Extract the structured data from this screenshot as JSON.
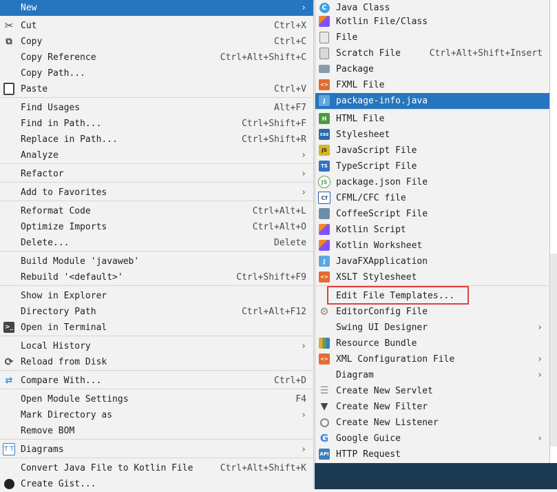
{
  "main_menu": {
    "items": [
      {
        "label": "New",
        "shortcut": "",
        "submenu": true,
        "selected": true,
        "icon": ""
      },
      {
        "label": "Cut",
        "shortcut": "Ctrl+X",
        "icon": "scissors-icon"
      },
      {
        "label": "Copy",
        "shortcut": "Ctrl+C",
        "icon": "copy-icon"
      },
      {
        "label": "Copy Reference",
        "shortcut": "Ctrl+Alt+Shift+C"
      },
      {
        "label": "Copy Path...",
        "shortcut": ""
      },
      {
        "label": "Paste",
        "shortcut": "Ctrl+V",
        "icon": "clipboard-icon"
      },
      {
        "label": "Find Usages",
        "shortcut": "Alt+F7"
      },
      {
        "label": "Find in Path...",
        "shortcut": "Ctrl+Shift+F"
      },
      {
        "label": "Replace in Path...",
        "shortcut": "Ctrl+Shift+R"
      },
      {
        "label": "Analyze",
        "shortcut": "",
        "submenu": true
      },
      {
        "label": "Refactor",
        "shortcut": "",
        "submenu": true
      },
      {
        "label": "Add to Favorites",
        "shortcut": "",
        "submenu": true
      },
      {
        "label": "Reformat Code",
        "shortcut": "Ctrl+Alt+L"
      },
      {
        "label": "Optimize Imports",
        "shortcut": "Ctrl+Alt+O"
      },
      {
        "label": "Delete...",
        "shortcut": "Delete"
      },
      {
        "label": "Build Module 'javaweb'",
        "shortcut": ""
      },
      {
        "label": "Rebuild '<default>'",
        "shortcut": "Ctrl+Shift+F9"
      },
      {
        "label": "Show in Explorer",
        "shortcut": ""
      },
      {
        "label": "Directory Path",
        "shortcut": "Ctrl+Alt+F12"
      },
      {
        "label": "Open in Terminal",
        "shortcut": "",
        "icon": "terminal-icon"
      },
      {
        "label": "Local History",
        "shortcut": "",
        "submenu": true
      },
      {
        "label": "Reload from Disk",
        "shortcut": "",
        "icon": "reload-icon"
      },
      {
        "label": "Compare With...",
        "shortcut": "Ctrl+D",
        "icon": "compare-icon"
      },
      {
        "label": "Open Module Settings",
        "shortcut": "F4"
      },
      {
        "label": "Mark Directory as",
        "shortcut": "",
        "submenu": true
      },
      {
        "label": "Remove BOM",
        "shortcut": ""
      },
      {
        "label": "Diagrams",
        "shortcut": "",
        "submenu": true,
        "icon": "diagram-icon"
      },
      {
        "label": "Convert Java File to Kotlin File",
        "shortcut": "Ctrl+Alt+Shift+K"
      },
      {
        "label": "Create Gist...",
        "shortcut": "",
        "icon": "github-icon"
      }
    ]
  },
  "sub_menu": {
    "items": [
      {
        "label": "Java Class",
        "shortcut": "",
        "icon": "java-class-icon"
      },
      {
        "label": "Kotlin File/Class",
        "shortcut": "",
        "icon": "kotlin-file-icon"
      },
      {
        "label": "File",
        "shortcut": "",
        "icon": "file-icon"
      },
      {
        "label": "Scratch File",
        "shortcut": "Ctrl+Alt+Shift+Insert",
        "icon": "scratch-file-icon"
      },
      {
        "label": "Package",
        "shortcut": "",
        "icon": "package-icon"
      },
      {
        "label": "FXML File",
        "shortcut": "",
        "icon": "fxml-file-icon"
      },
      {
        "label": "package-info.java",
        "shortcut": "",
        "selected": true,
        "icon": "java-file-icon"
      },
      {
        "label": "HTML File",
        "shortcut": "",
        "icon": "html-file-icon"
      },
      {
        "label": "Stylesheet",
        "shortcut": "",
        "icon": "css-file-icon"
      },
      {
        "label": "JavaScript File",
        "shortcut": "",
        "icon": "js-file-icon"
      },
      {
        "label": "TypeScript File",
        "shortcut": "",
        "icon": "ts-file-icon"
      },
      {
        "label": "package.json File",
        "shortcut": "",
        "icon": "nodejs-icon"
      },
      {
        "label": "CFML/CFC file",
        "shortcut": "",
        "icon": "cfml-icon"
      },
      {
        "label": "CoffeeScript File",
        "shortcut": "",
        "icon": "coffeescript-icon"
      },
      {
        "label": "Kotlin Script",
        "shortcut": "",
        "icon": "kotlin-script-icon"
      },
      {
        "label": "Kotlin Worksheet",
        "shortcut": "",
        "icon": "kotlin-worksheet-icon"
      },
      {
        "label": "JavaFXApplication",
        "shortcut": "",
        "icon": "javafx-icon"
      },
      {
        "label": "XSLT Stylesheet",
        "shortcut": "",
        "icon": "xslt-icon"
      },
      {
        "label": "Edit File Templates...",
        "shortcut": "",
        "highlighted": true
      },
      {
        "label": "EditorConfig File",
        "shortcut": "",
        "icon": "gear-icon"
      },
      {
        "label": "Swing UI Designer",
        "shortcut": "",
        "submenu": true
      },
      {
        "label": "Resource Bundle",
        "shortcut": "",
        "icon": "resource-bundle-icon"
      },
      {
        "label": "XML Configuration File",
        "shortcut": "",
        "submenu": true,
        "icon": "xml-file-icon"
      },
      {
        "label": "Diagram",
        "shortcut": "",
        "submenu": true
      },
      {
        "label": "Create New Servlet",
        "shortcut": "",
        "icon": "servlet-icon"
      },
      {
        "label": "Create New Filter",
        "shortcut": "",
        "icon": "filter-icon"
      },
      {
        "label": "Create New Listener",
        "shortcut": "",
        "icon": "listener-icon"
      },
      {
        "label": "Google Guice",
        "shortcut": "",
        "submenu": true,
        "icon": "google-icon"
      },
      {
        "label": "HTTP Request",
        "shortcut": "",
        "icon": "api-icon"
      }
    ]
  },
  "submenu_arrow": "›",
  "colors": {
    "selection": "#2675bf",
    "highlight_box": "#e0403f"
  }
}
